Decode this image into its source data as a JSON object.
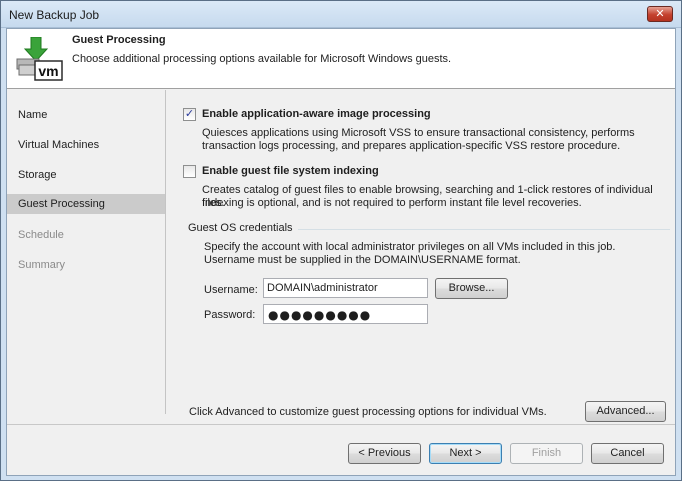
{
  "window": {
    "title": "New Backup Job",
    "close_glyph": "✕"
  },
  "header": {
    "title": "Guest Processing",
    "subtitle": "Choose additional processing options available for Microsoft Windows guests.",
    "icon": "vm-download-icon",
    "icon_text": "vm"
  },
  "sidebar": {
    "items": [
      {
        "label": "Name"
      },
      {
        "label": "Virtual Machines"
      },
      {
        "label": "Storage"
      },
      {
        "label": "Guest Processing"
      },
      {
        "label": "Schedule"
      },
      {
        "label": "Summary"
      }
    ],
    "active_index": 3
  },
  "options": {
    "app_aware": {
      "label": "Enable application-aware image processing",
      "checked": true,
      "check_glyph": "✓",
      "desc1": "Quiesces applications using Microsoft VSS to ensure transactional consistency, performs",
      "desc2": "transaction logs processing, and prepares application-specific VSS restore procedure."
    },
    "indexing": {
      "label": "Enable guest file system indexing",
      "checked": false,
      "desc1": "Creates catalog of guest files to enable browsing, searching and 1-click restores of individual files.",
      "desc2": "Indexing is optional, and is not required to perform instant file level recoveries."
    }
  },
  "credentials": {
    "group_label": "Guest OS credentials",
    "desc1": "Specify the account with local administrator privileges on all VMs included in this job.",
    "desc2": "Username must be supplied in the DOMAIN\\USERNAME format.",
    "username_label": "Username:",
    "username_value": "DOMAIN\\administrator",
    "browse_label": "Browse...",
    "password_label": "Password:",
    "password_mask": "●●●●●●●●●"
  },
  "advanced": {
    "text": "Click Advanced to customize guest processing options for individual VMs.",
    "button_label": "Advanced..."
  },
  "footer": {
    "previous_label": "< Previous",
    "next_label": "Next >",
    "finish_label": "Finish",
    "cancel_label": "Cancel"
  },
  "colors": {
    "title_bar": "#c6daee",
    "sidebar_active": "#cbcbcb",
    "close_button": "#c4412e",
    "icon_green": "#3aa33a"
  }
}
